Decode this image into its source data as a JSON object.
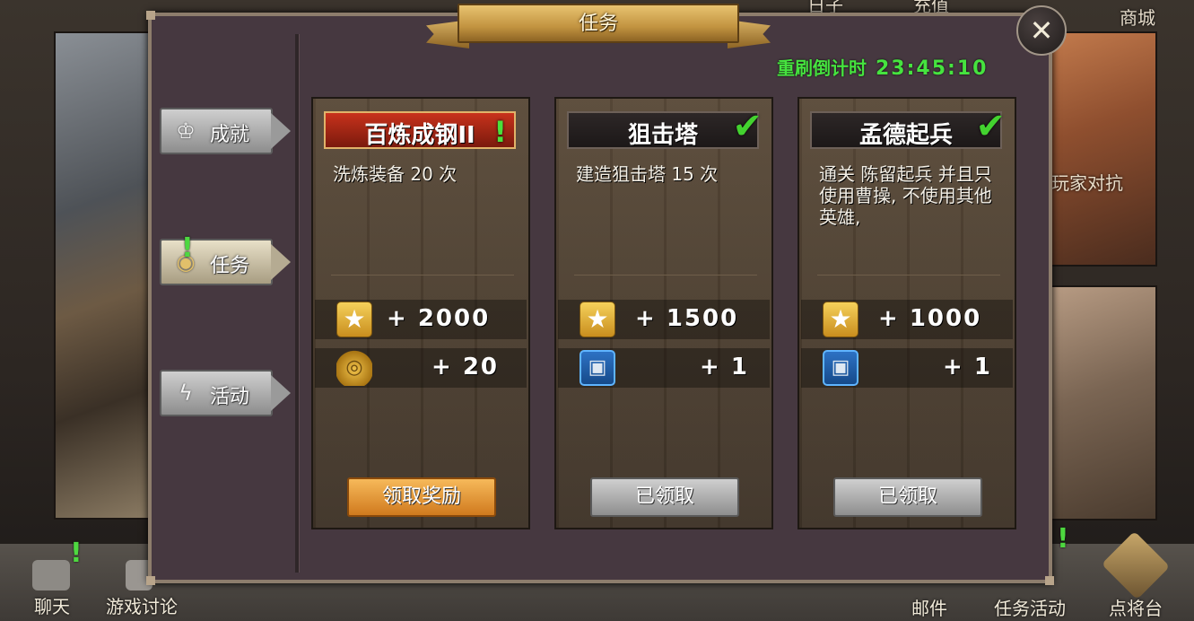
{
  "background": {
    "top_nav": [
      "日子",
      "充值",
      "商城"
    ],
    "right_panel_label": "玩家对抗"
  },
  "bottom_bar": {
    "items": [
      {
        "label": "聊天",
        "icon": "chat-icon"
      },
      {
        "label": "游戏讨论",
        "icon": "people-icon"
      },
      {
        "label": "邮件",
        "icon": "mail-icon"
      },
      {
        "label": "任务活动",
        "icon": "quest-icon"
      },
      {
        "label": "点将台",
        "icon": "hero-altar-icon"
      }
    ]
  },
  "dialog": {
    "title": "任务",
    "close_icon": "close-icon",
    "refresh_label": "重刷倒计时",
    "refresh_time": "23:45:10"
  },
  "tabs": [
    {
      "label": "成就",
      "icon": "crown-icon",
      "active": false
    },
    {
      "label": "任务",
      "icon": "scroll-icon",
      "active": true,
      "alert": "!"
    },
    {
      "label": "活动",
      "icon": "lightning-icon",
      "active": false
    }
  ],
  "quests": [
    {
      "title": "百炼成钢II",
      "status": "alert",
      "description": "洗炼装备 20 次",
      "rewards": [
        {
          "icon": "star-icon",
          "value": "+ 2000"
        },
        {
          "icon": "gold-coins-icon",
          "value": "+ 20"
        }
      ],
      "button": "领取奖励"
    },
    {
      "title": "狙击塔",
      "status": "completed",
      "description": "建造狙击塔 15 次",
      "rewards": [
        {
          "icon": "star-icon",
          "value": "+ 1500"
        },
        {
          "icon": "card-icon",
          "value": "+ 1"
        }
      ],
      "button": "已领取"
    },
    {
      "title": "孟德起兵",
      "status": "completed",
      "description": "通关 陈留起兵 并且只使用曹操, 不使用其他英雄,",
      "rewards": [
        {
          "icon": "star-icon",
          "value": "+ 1000"
        },
        {
          "icon": "card-icon",
          "value": "+ 1"
        }
      ],
      "button": "已领取"
    }
  ],
  "colors": {
    "accent_green": "#46e33f",
    "claim_button": "#e8962f",
    "claimed_button": "#a8a8a8",
    "alert_title": "#b32a17"
  }
}
